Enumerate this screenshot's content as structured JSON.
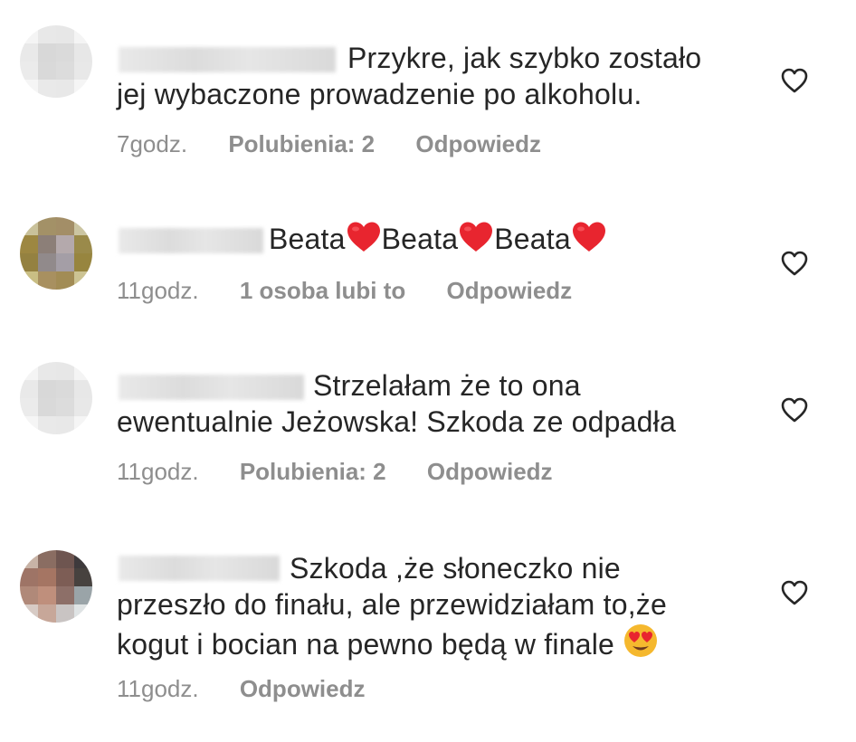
{
  "comments": [
    {
      "line1": "Przykre, jak szybko zostało",
      "line2": "jej wybaczone prowadzenie po alkoholu.",
      "time": "7godz.",
      "likes": "Polubienia: 2",
      "reply": "Odpowiedz",
      "avatar_colors": [
        "#f4f4f4",
        "#e8e8e8",
        "#e7e7e7",
        "#f4f4f4",
        "#e9e9e9",
        "#d8d8d8",
        "#dadada",
        "#e7e7e7",
        "#ebebeb",
        "#d9d9d9",
        "#dcdcdc",
        "#e8e8e8",
        "#f5f5f5",
        "#e9e9e9",
        "#e8e8e8",
        "#f5f5f5"
      ]
    },
    {
      "line1_parts": [
        "Beata",
        "Beata",
        "Beata"
      ],
      "time": "11godz.",
      "likes": "1 osoba lubi to",
      "reply": "Odpowiedz",
      "avatar_colors": [
        "#c9c19a",
        "#a39167",
        "#a38e67",
        "#cbc5a2",
        "#9d8741",
        "#8c7f78",
        "#b4a9ac",
        "#9a8a4a",
        "#948140",
        "#918a8b",
        "#a49ea6",
        "#97853f",
        "#c9be84",
        "#a89060",
        "#a28c55",
        "#ccc393"
      ]
    },
    {
      "line1": "Strzelałam że to ona",
      "line2": "ewentualnie Jeżowska! Szkoda ze odpadła",
      "time": "11godz.",
      "likes": "Polubienia: 2",
      "reply": "Odpowiedz",
      "avatar_colors": [
        "#f4f4f4",
        "#e8e8e8",
        "#e7e7e7",
        "#f4f4f4",
        "#e9e9e9",
        "#d8d8d8",
        "#dadada",
        "#e7e7e7",
        "#ebebeb",
        "#d9d9d9",
        "#dcdcdc",
        "#e8e8e8",
        "#f5f5f5",
        "#e9e9e9",
        "#e8e8e8",
        "#f5f5f5"
      ]
    },
    {
      "line1": "Szkoda ,że słoneczko nie",
      "line2": "przeszło do finału, ale przewidziałam to,że",
      "line3": "kogut i bocian na pewno będą w finale",
      "time": "11godz.",
      "reply": "Odpowiedz",
      "avatar_colors": [
        "#c8b3a6",
        "#8a6d62",
        "#6e5550",
        "#3e3a3c",
        "#9e7466",
        "#a57563",
        "#7d5d55",
        "#47423f",
        "#b08979",
        "#bf8f7c",
        "#8d6f68",
        "#9aa4a8",
        "#d7cbc5",
        "#c7a799",
        "#c9c4c3",
        "#dfe3e4"
      ]
    }
  ],
  "icons": {
    "like": "heart-outline-icon",
    "emoji_heart": "red-heart-icon",
    "emoji_face": "heart-eyes-face-icon"
  },
  "colors": {
    "text": "#262626",
    "meta": "#8e8e8e",
    "heart_red": "#e8252f",
    "emoji_yellow": "#f5b82e"
  }
}
